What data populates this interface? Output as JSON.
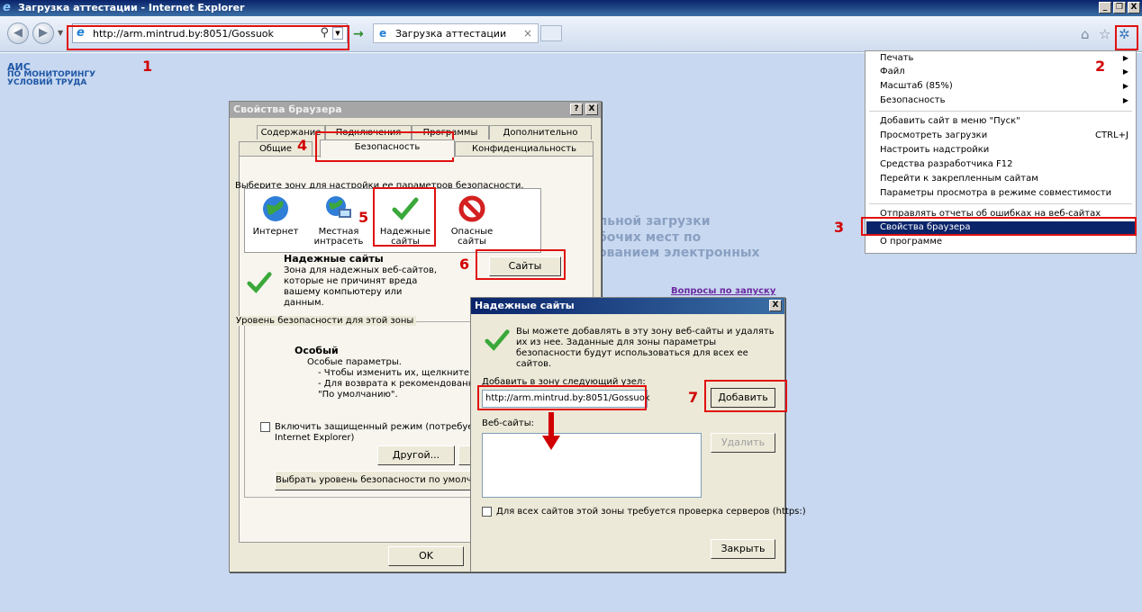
{
  "window": {
    "title": "Загрузка аттестации - Internet Explorer",
    "min": "_",
    "max": "❐",
    "close": "X"
  },
  "navbar": {
    "url": "http://arm.mintrud.by:8051/Gossuok",
    "tab_label": "Загрузка аттестации",
    "tab_close": "×",
    "search_glyph": "⚲",
    "go_glyph": "→"
  },
  "page": {
    "brand": [
      "АИС",
      "ПО МОНИТОРИНГУ",
      "УСЛОВИЙ ТРУДА"
    ],
    "faded_lines": [
      "льной загрузки",
      "бочих мест по",
      "ованием электронных"
    ],
    "questions_link": "Вопросы по запуску"
  },
  "markers": [
    "1",
    "2",
    "3",
    "4",
    "5",
    "6",
    "7"
  ],
  "props_dialog": {
    "title": "Свойства браузера",
    "help": "?",
    "close": "X",
    "tabs_row1": [
      "Содержание",
      "Подключения",
      "Программы",
      "Дополнительно"
    ],
    "tabs_row2": [
      "Общие",
      "Безопасность",
      "Конфиденциальность"
    ],
    "zone_prompt": "Выберите зону для настройки ее параметров безопасности.",
    "zones": [
      {
        "label": "Интернет",
        "icon": "globe-icon"
      },
      {
        "label": "Местная интрасеть",
        "icon": "intranet-icon"
      },
      {
        "label": "Надежные сайты",
        "icon": "checkmark-icon"
      },
      {
        "label": "Опасные сайты",
        "icon": "restricted-icon"
      }
    ],
    "zone_heading": "Надежные сайты",
    "zone_desc": "Зона для надежных веб-сайтов, которые не причинят вреда вашему компьютеру или данным.",
    "sites_button": "Сайты",
    "level_group": "Уровень безопасности для этой зоны",
    "level_title": "Особый",
    "level_lines": [
      "Особые параметры.",
      "- Чтобы изменить их, щелкните \"Друго",
      "- Для возврата к рекомендованному ур",
      "\"По умолчанию\"."
    ],
    "protected_mode": "Включить защищенный режим (потребуется п",
    "protected_mode_2": "Internet Explorer)",
    "other_button": "Другой...",
    "default_level_button": "Выбрать уровень безопасности по умолчан",
    "ok_button": "OK"
  },
  "trusted_dialog": {
    "title": "Надежные сайты",
    "close": "X",
    "info": "Вы можете добавлять в эту зону веб-сайты и удалять их из нее. Заданные для зоны параметры безопасности будут использоваться для всех ее сайтов.",
    "add_label": "Добавить в зону следующий узел:",
    "add_value": "http://arm.mintrud.by:8051/Gossuok",
    "add_button": "Добавить",
    "sites_label": "Веб-сайты:",
    "remove_button": "Удалить",
    "https_check": "Для всех сайтов этой зоны требуется проверка серверов (https:)",
    "close_button": "Закрыть"
  },
  "menu": {
    "items": [
      {
        "label": "Печать",
        "shortcut": "",
        "submenu": true
      },
      {
        "label": "Файл",
        "shortcut": "",
        "submenu": true
      },
      {
        "label": "Масштаб (85%)",
        "shortcut": "",
        "submenu": true
      },
      {
        "label": "Безопасность",
        "shortcut": "",
        "submenu": true
      },
      {
        "label": "Добавить сайт в меню \"Пуск\"",
        "shortcut": "",
        "submenu": false
      },
      {
        "label": "Просмотреть загрузки",
        "shortcut": "CTRL+J",
        "submenu": false
      },
      {
        "label": "Настроить надстройки",
        "shortcut": "",
        "submenu": false
      },
      {
        "label": "Средства разработчика F12",
        "shortcut": "",
        "submenu": false
      },
      {
        "label": "Перейти к закрепленным сайтам",
        "shortcut": "",
        "submenu": false
      },
      {
        "label": "Параметры просмотра в режиме совместимости",
        "shortcut": "",
        "submenu": false
      },
      {
        "label": "Отправлять отчеты об ошибках на веб-сайтах",
        "shortcut": "",
        "submenu": false
      },
      {
        "label": "Свойства браузера",
        "shortcut": "",
        "submenu": false
      },
      {
        "label": "О программе",
        "shortcut": "",
        "submenu": false
      }
    ],
    "highlight_color": "#0a246a"
  },
  "colors": {
    "marker": "#d10000",
    "page_bg": "#c8d8f0"
  }
}
